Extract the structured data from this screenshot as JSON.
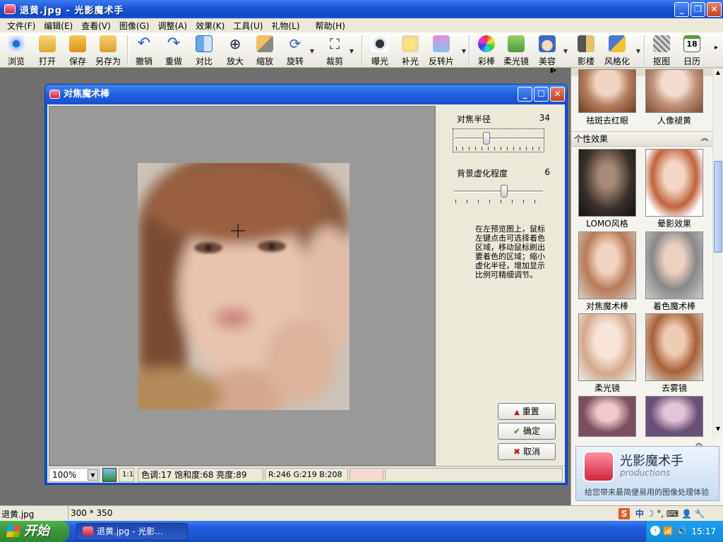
{
  "app": {
    "title": "退黄.jpg - 光影魔术手"
  },
  "menu": [
    "文件(F)",
    "编辑(E)",
    "查看(V)",
    "图像(G)",
    "调整(A)",
    "效果(K)",
    "工具(U)",
    "礼物(L)",
    "帮助(H)"
  ],
  "toolbar": {
    "items": [
      {
        "label": "浏览",
        "icon": "eye-icon"
      },
      {
        "label": "打开",
        "icon": "folder-open-icon"
      },
      {
        "label": "保存",
        "icon": "save-icon"
      },
      {
        "label": "另存为",
        "icon": "save-as-icon"
      },
      {
        "label": "撤销",
        "icon": "undo-icon"
      },
      {
        "label": "重做",
        "icon": "redo-icon"
      },
      {
        "label": "对比",
        "icon": "compare-icon"
      },
      {
        "label": "放大",
        "icon": "zoom-in-icon"
      },
      {
        "label": "缩放",
        "icon": "resize-icon"
      },
      {
        "label": "旋转",
        "icon": "rotate-icon"
      },
      {
        "label": "裁剪",
        "icon": "crop-icon"
      },
      {
        "label": "曝光",
        "icon": "exposure-icon"
      },
      {
        "label": "补光",
        "icon": "fill-light-icon"
      },
      {
        "label": "反转片",
        "icon": "reversal-film-icon"
      },
      {
        "label": "彩棒",
        "icon": "color-wand-icon"
      },
      {
        "label": "柔光镜",
        "icon": "soft-light-icon"
      },
      {
        "label": "美容",
        "icon": "beauty-icon"
      },
      {
        "label": "影楼",
        "icon": "studio-icon"
      },
      {
        "label": "风格化",
        "icon": "stylize-icon"
      },
      {
        "label": "抠图",
        "icon": "cutout-icon"
      },
      {
        "label": "日历",
        "icon": "calendar-icon",
        "badge": "18"
      }
    ]
  },
  "dialog": {
    "title": "对焦魔术棒",
    "radius": {
      "label": "对焦半径",
      "value": "34"
    },
    "blur": {
      "label": "背景虚化程度",
      "value": "6"
    },
    "help": "在左预览图上，鼠标左键点击可选择着色区域，移动鼠标刷出要着色的区域；缩小虚化半径，增加显示比例可精细调节。",
    "buttons": {
      "reset": "重置",
      "ok": "确定",
      "cancel": "取消"
    },
    "status": {
      "zoom": "100%",
      "ratio": "1:1",
      "hsb": "色调:17 饱和度:68 亮度:89",
      "rgb": "R:246 G:219 B:208",
      "swatch": "#f6dbd0"
    }
  },
  "panel": {
    "top_labels": [
      "祛斑去红眼",
      "人像褪黄"
    ],
    "section": "个性效果",
    "effects": [
      "LOMO风格",
      "晕影效果",
      "对焦魔术棒",
      "着色魔术棒",
      "柔光镜",
      "去雾镜"
    ],
    "logo_title": "光影魔术手",
    "logo_sub": "productions",
    "logo_slogan": "给您带来最简便易用的图像处理体验"
  },
  "statusbar": {
    "filename": "退黄.jpg",
    "size": "300 * 350"
  },
  "taskbar": {
    "start": "开始",
    "task": "退黄.jpg - 光影...",
    "clock": "15:17",
    "ime": "中"
  },
  "colors": {
    "xp_blue": "#0b53d6",
    "face_bg": "#ece9d8"
  }
}
